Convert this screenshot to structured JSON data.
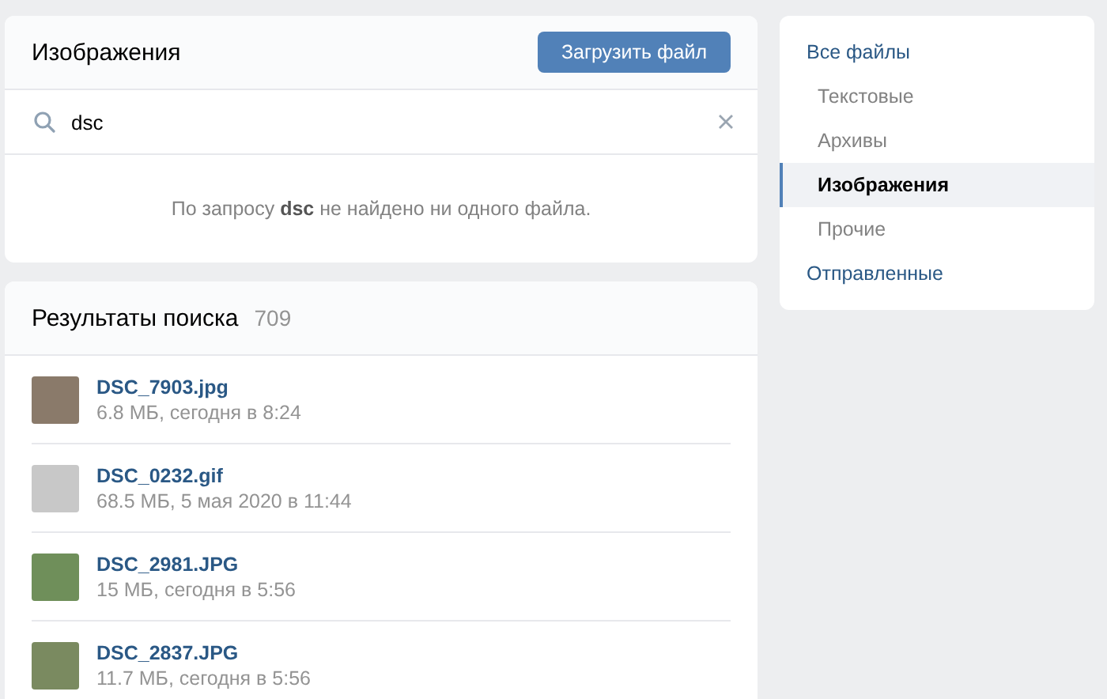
{
  "files_panel": {
    "title": "Изображения",
    "upload_button": "Загрузить файл",
    "search": {
      "value": "dsc"
    },
    "empty_message": "По запросу **dsc** не найдено ни одного файла."
  },
  "results": {
    "title": "Результаты поиска",
    "count": "709",
    "items": [
      {
        "name": "DSC_7903.jpg",
        "meta": "6.8 МБ, сегодня в 8:24"
      },
      {
        "name": "DSC_0232.gif",
        "meta": "68.5 МБ, 5 мая 2020 в 11:44"
      },
      {
        "name": "DSC_2981.JPG",
        "meta": "15 МБ, сегодня в 5:56"
      },
      {
        "name": "DSC_2837.JPG",
        "meta": "11.7 МБ, сегодня в 5:56"
      }
    ]
  },
  "sidebar": {
    "items": [
      {
        "label": "Все файлы",
        "selected": false,
        "children": [
          {
            "label": "Текстовые",
            "selected": false
          },
          {
            "label": "Архивы",
            "selected": false
          },
          {
            "label": "Изображения",
            "selected": true
          },
          {
            "label": "Прочие",
            "selected": false
          }
        ]
      },
      {
        "label": "Отправленные",
        "selected": false
      }
    ]
  }
}
